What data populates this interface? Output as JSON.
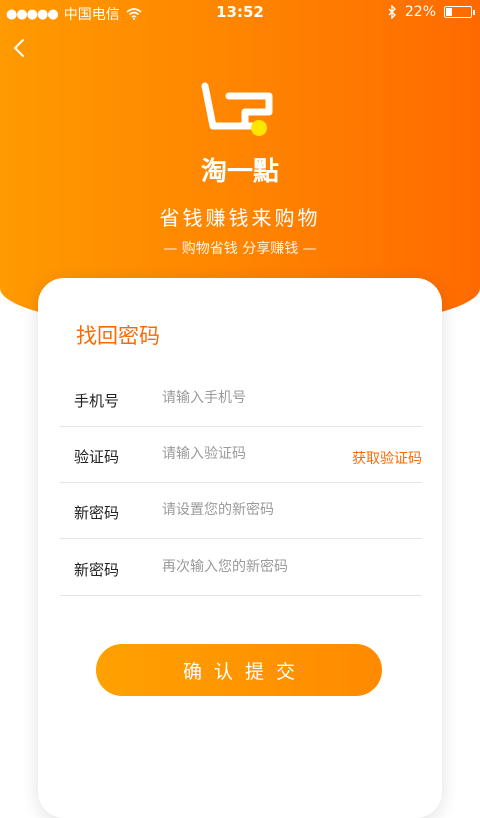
{
  "status_bar": {
    "signal": "●●●●●",
    "carrier": "中国电信",
    "time": "13:52",
    "battery_text": "22%",
    "battery_level": 0.22
  },
  "header": {
    "back_icon": "chevron-left-icon",
    "logo_text": "淘一點",
    "slogan": "省钱赚钱来购物",
    "tagline": "— 购物省钱  分享赚钱 —"
  },
  "form": {
    "title": "找回密码",
    "fields": [
      {
        "label": "手机号",
        "placeholder": "请输入手机号",
        "value": ""
      },
      {
        "label": "验证码",
        "placeholder": "请输入验证码",
        "value": ""
      },
      {
        "label": "新密码",
        "placeholder": "请设置您的新密码",
        "value": ""
      },
      {
        "label": "新密码",
        "placeholder": "再次输入您的新密码",
        "value": ""
      }
    ],
    "get_code_label": "获取验证码",
    "submit_label": "确认提交"
  },
  "colors": {
    "accent": "#ff6a00",
    "hero_start": "#ff9a00",
    "hero_end": "#ff6a00",
    "button": "#ff9000"
  }
}
